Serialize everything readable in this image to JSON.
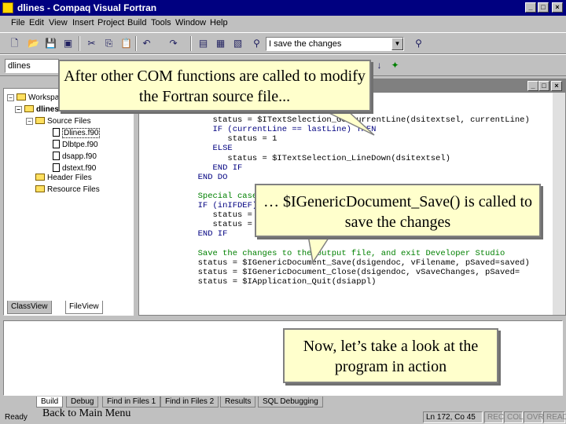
{
  "window": {
    "title": "dlines - Compaq Visual Fortran"
  },
  "menu": [
    "File",
    "Edit",
    "View",
    "Insert",
    "Project",
    "Build",
    "Tools",
    "Window",
    "Help"
  ],
  "toolbar": {
    "find_value": "I save the changes"
  },
  "toolbar2": {
    "config_value": "dlines"
  },
  "workspace": {
    "root_label": "Workspace",
    "project_label": "dlines",
    "source_folder": "Source Files",
    "files": [
      "Dlines.f90",
      "Dlbtpe.f90",
      "dsapp.f90",
      "dstext.f90"
    ],
    "header_folder": "Header Files",
    "resource_folder": "Resource Files",
    "tabs": [
      "ClassView",
      "FileView"
    ]
  },
  "editor": {
    "code_lines": [
      {
        "text": "        END IF",
        "cls": "kw"
      },
      {
        "text": "     END IF",
        "cls": "kw"
      },
      {
        "text": "     status = $ITextSelection_GetCurrentLine(dsitextsel, currentLine)",
        "cls": ""
      },
      {
        "text": "     IF (currentLine == lastLine) THEN",
        "cls": "kw"
      },
      {
        "text": "        status = 1",
        "cls": ""
      },
      {
        "text": "     ELSE",
        "cls": "kw"
      },
      {
        "text": "        status = $ITextSelection_LineDown(dsitextsel)",
        "cls": ""
      },
      {
        "text": "     END IF",
        "cls": "kw"
      },
      {
        "text": "  END DO",
        "cls": "kw"
      },
      {
        "text": "",
        "cls": ""
      },
      {
        "text": "  Special case",
        "cls": "cm"
      },
      {
        "text": "  IF (inIFDEF)",
        "cls": "kw"
      },
      {
        "text": "     status = $",
        "cls": ""
      },
      {
        "text": "     status = $ITextSelection_(dsitextsel, currentLine)",
        "cls": ""
      },
      {
        "text": "  END IF",
        "cls": "kw"
      },
      {
        "text": "",
        "cls": ""
      },
      {
        "text": "  Save the changes to the output file, and exit Developer Studio",
        "cls": "cm"
      },
      {
        "text": "  status = $IGenericDocument_Save(dsigendoc, vFilename, pSaved=saved)",
        "cls": ""
      },
      {
        "text": "  status = $IGenericDocument_Close(dsigendoc, vSaveChanges, pSaved=",
        "cls": ""
      },
      {
        "text": "  status = $IApplication_Quit(dsiappl)",
        "cls": ""
      }
    ]
  },
  "output_tabs": [
    "Build",
    "Debug",
    "Find in Files 1",
    "Find in Files 2",
    "Results",
    "SQL Debugging"
  ],
  "status": {
    "ready": "Ready",
    "position": "Ln 172, Co 45",
    "indicators": [
      "REC",
      "COL",
      "OVR",
      "READ"
    ]
  },
  "callouts": {
    "first": "After other COM functions are called to modify the Fortran source file...",
    "second": "… $IGenericDocument_Save() is called to save the changes",
    "third": "Now, let’s take a look at the program in action"
  },
  "back_link": "Back to Main Menu"
}
